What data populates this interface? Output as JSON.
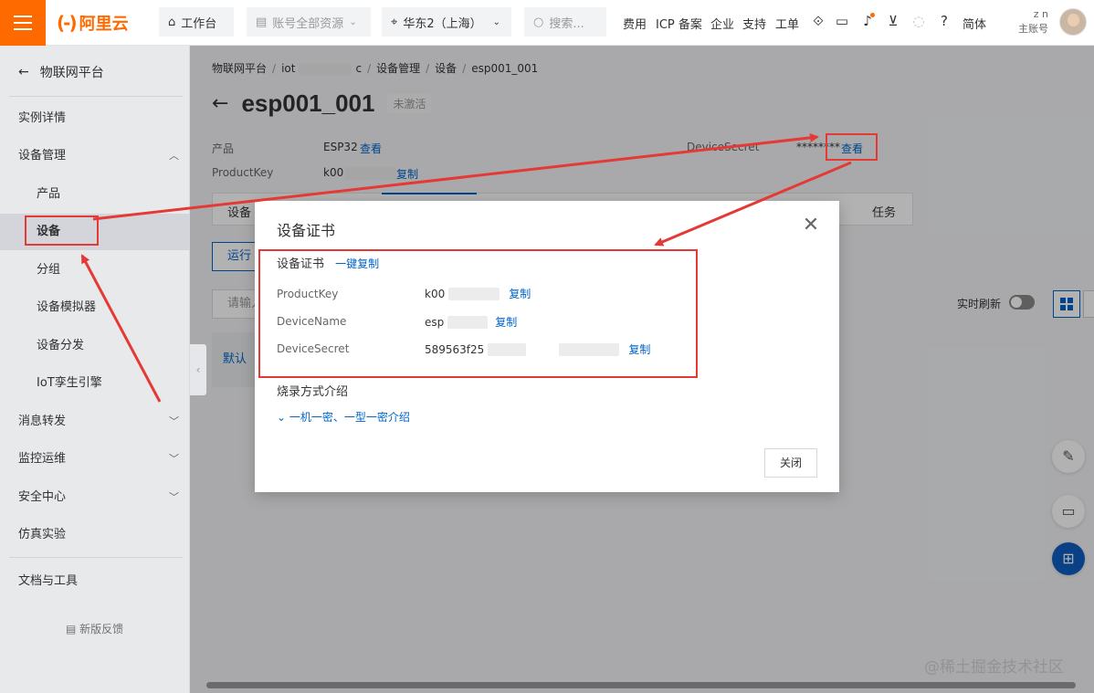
{
  "topbar": {
    "logo_text": "阿里云",
    "workbench": "工作台",
    "account_resources": "账号全部资源",
    "region": "华东2（上海）",
    "search_placeholder": "搜索...",
    "links": [
      "费用",
      "ICP 备案",
      "企业",
      "支持",
      "工单"
    ],
    "lang": "简体",
    "user_line1": "z          n",
    "user_line2": "主账号"
  },
  "sidebar": {
    "back_label": "物联网平台",
    "items": [
      {
        "label": "实例详情"
      },
      {
        "label": "设备管理",
        "expandable": true,
        "expanded": true
      },
      {
        "label": "产品"
      },
      {
        "label": "设备",
        "active": true
      },
      {
        "label": "分组"
      },
      {
        "label": "设备模拟器"
      },
      {
        "label": "设备分发"
      },
      {
        "label": "IoT孪生引擎"
      },
      {
        "label": "消息转发",
        "expandable": true
      },
      {
        "label": "监控运维",
        "expandable": true
      },
      {
        "label": "安全中心",
        "expandable": true
      },
      {
        "label": "仿真实验"
      },
      {
        "label": "文档与工具"
      }
    ],
    "feedback": "新版反馈"
  },
  "main": {
    "breadcrumb": [
      "物联网平台",
      "iot",
      "c",
      "设备管理",
      "设备",
      "esp001_001"
    ],
    "title": "esp001_001",
    "status": "未激活",
    "product_label": "产品",
    "product_value": "ESP32",
    "view_link": "查看",
    "productkey_label": "ProductKey",
    "productkey_value": "k00",
    "copy_link": "复制",
    "devicesecret_label": "DeviceSecret",
    "devicesecret_value": "********",
    "devicesecret_view": "查看",
    "tab_first": "设备",
    "tab_last": "任务",
    "run_button": "运行",
    "search_placeholder": "请输入",
    "realtime_label": "实时刷新",
    "group_card": "默认"
  },
  "dialog": {
    "title": "设备证书",
    "section_title": "设备证书",
    "copy_all": "一键复制",
    "rows": [
      {
        "label": "ProductKey",
        "value": "k00",
        "copy": "复制"
      },
      {
        "label": "DeviceName",
        "value": "esp",
        "copy": "复制"
      },
      {
        "label": "DeviceSecret",
        "value": "589563f25",
        "copy": "复制"
      }
    ],
    "burn_title": "烧录方式介绍",
    "burn_toggle": "一机一密、一型一密介绍",
    "close_button": "关闭"
  },
  "watermark": "@稀土掘金技术社区",
  "colors": {
    "brand": "#ff6a00",
    "link": "#0064c8",
    "annotation": "#e53935"
  }
}
